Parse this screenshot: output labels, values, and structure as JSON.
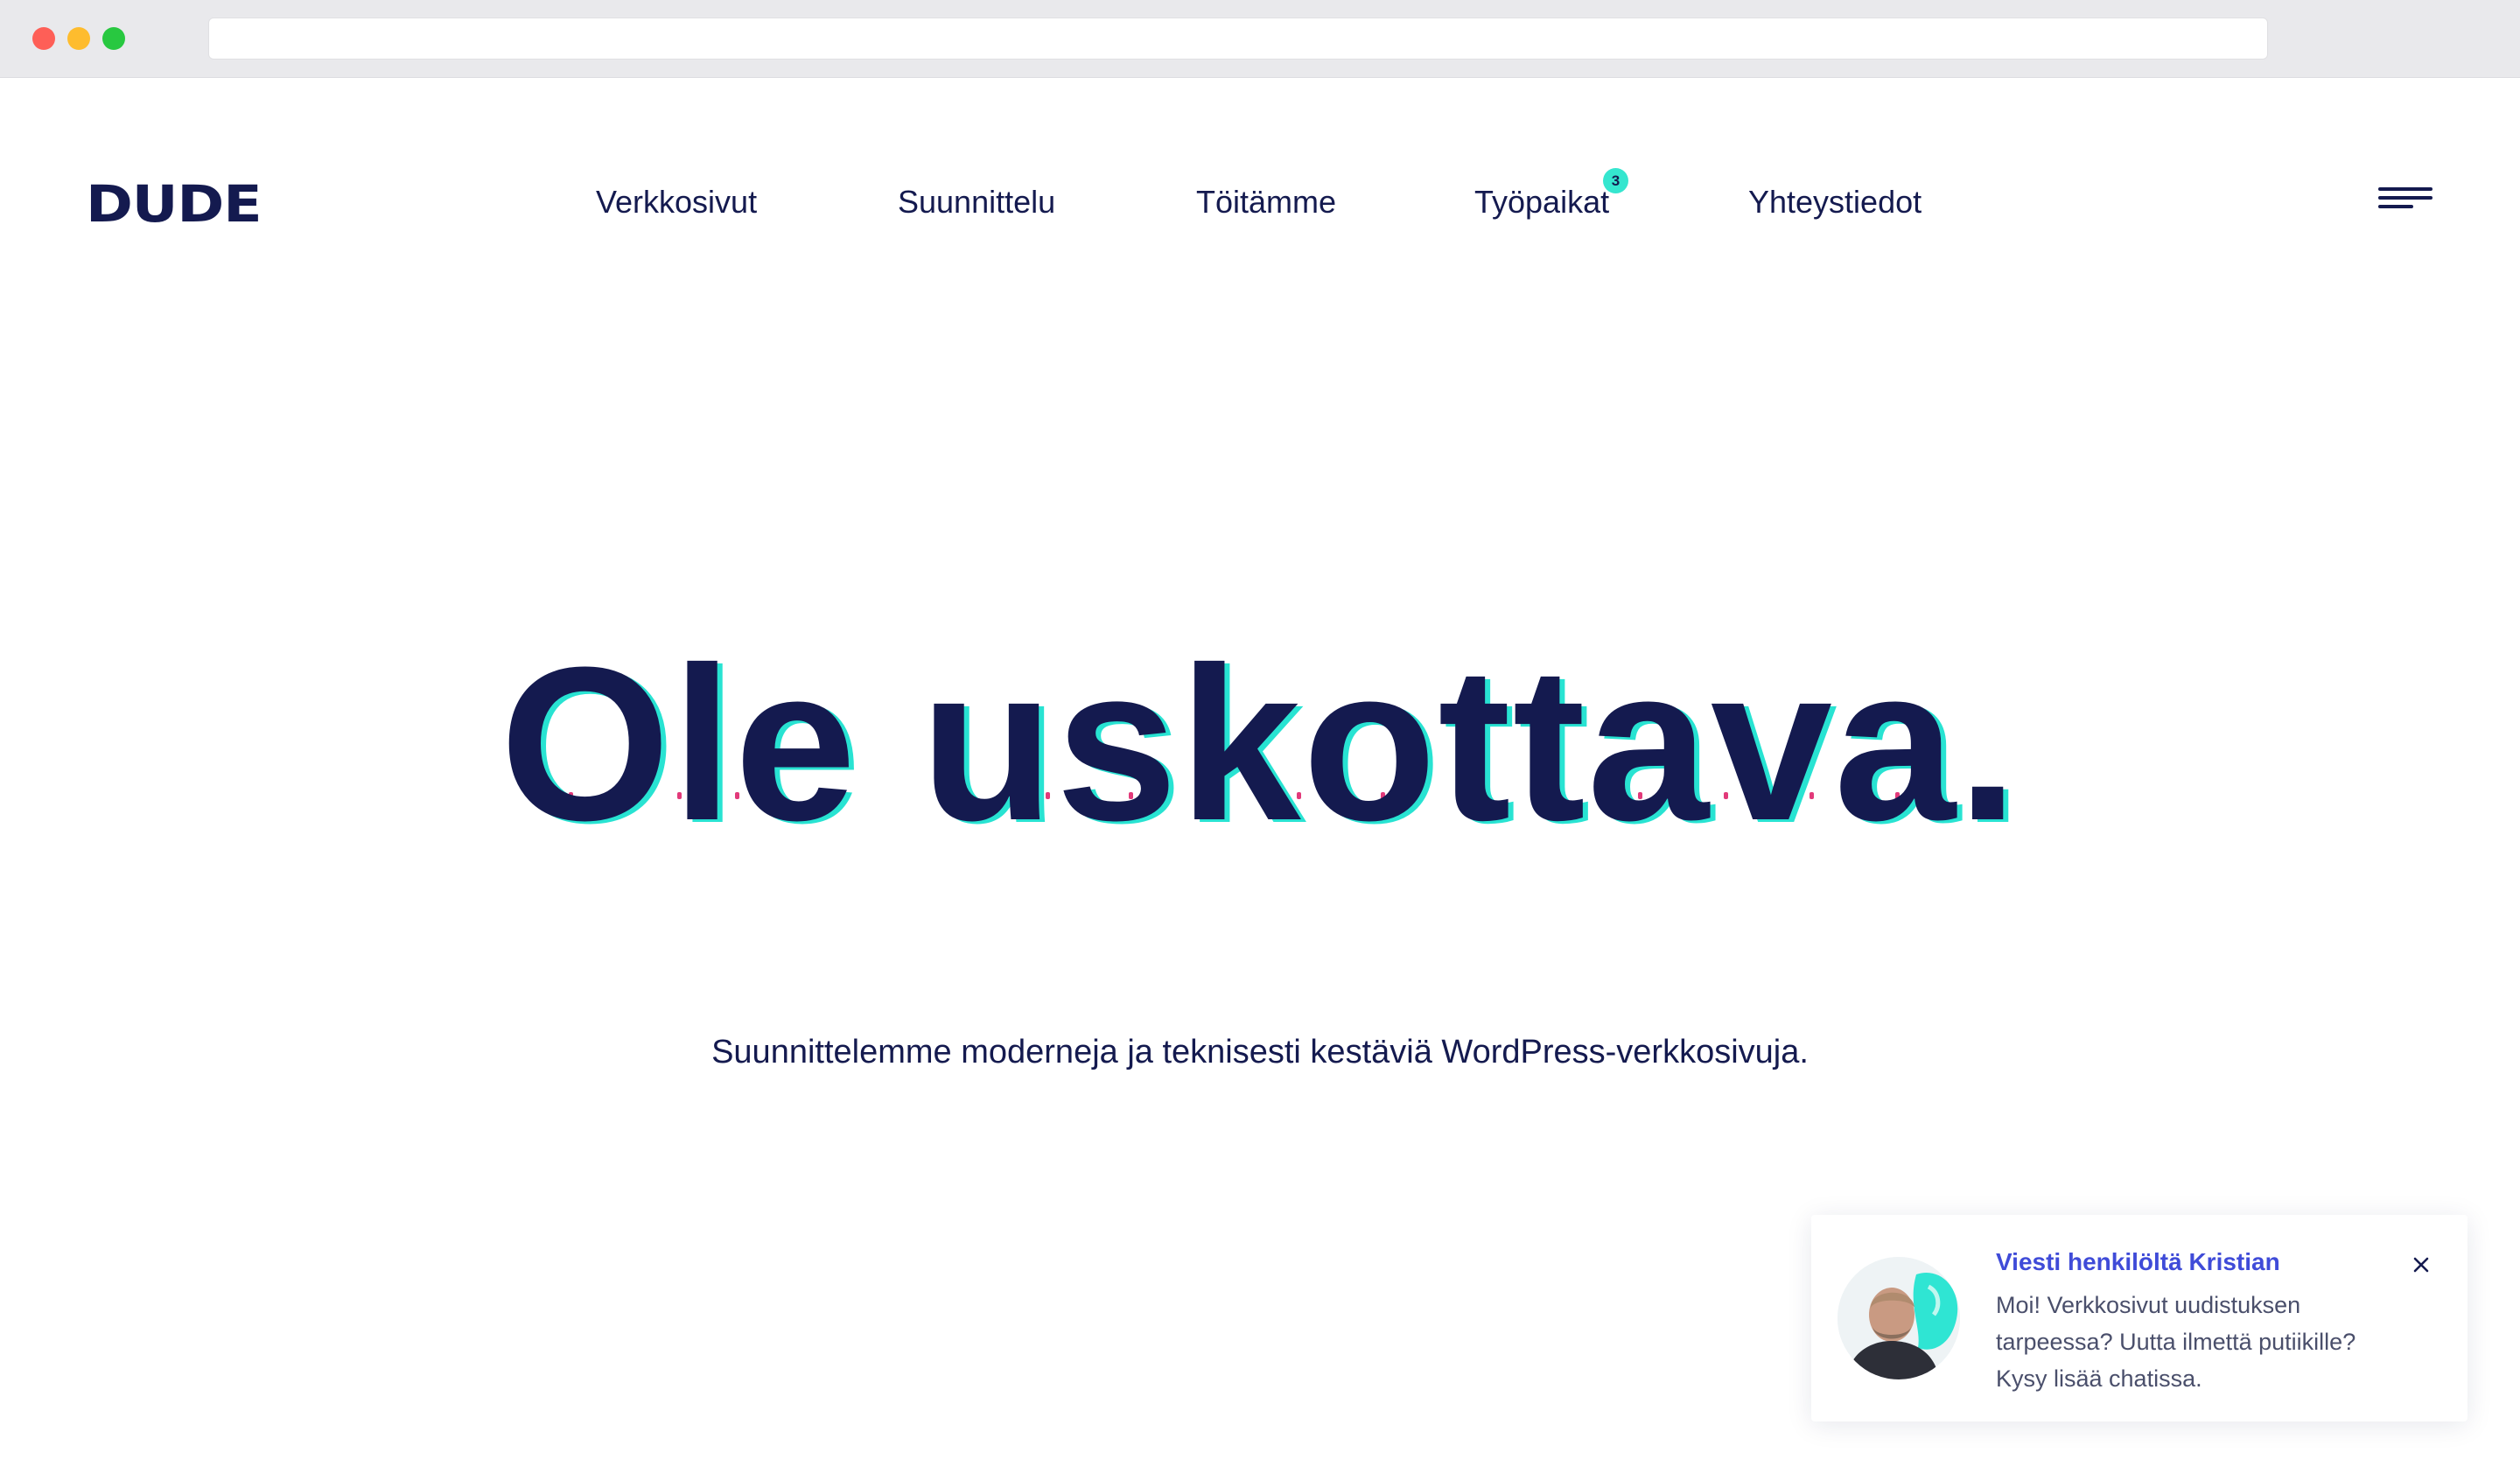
{
  "browser": {
    "window_controls": [
      "close",
      "minimize",
      "maximize"
    ],
    "address": ""
  },
  "header": {
    "logo": "DUDE",
    "nav": [
      {
        "label": "Verkkosivut"
      },
      {
        "label": "Suunnittelu"
      },
      {
        "label": "Töitämme"
      },
      {
        "label": "Työpaikat",
        "badge": "3"
      },
      {
        "label": "Yhteystiedot"
      }
    ],
    "menu_icon": "hamburger-icon"
  },
  "hero": {
    "title": "Ole uskottava.",
    "subtitle": "Suunnittelemme moderneja ja teknisesti kestäviä WordPress-verkkosivuja."
  },
  "chat": {
    "title": "Viesti henkilöltä Kristian",
    "lines": [
      "Moi! Verkkosivut uudistuksen",
      "tarpeessa? Uutta ilmettä putiikille?",
      "Kysy lisää chatissa."
    ],
    "close_icon": "close-icon",
    "avatar_icon": "avatar-photo"
  },
  "colors": {
    "brand_navy": "#141a4f",
    "accent_cyan": "#28e3d2",
    "accent_pink": "#e23a7a",
    "link_blue": "#3f4bd8"
  }
}
